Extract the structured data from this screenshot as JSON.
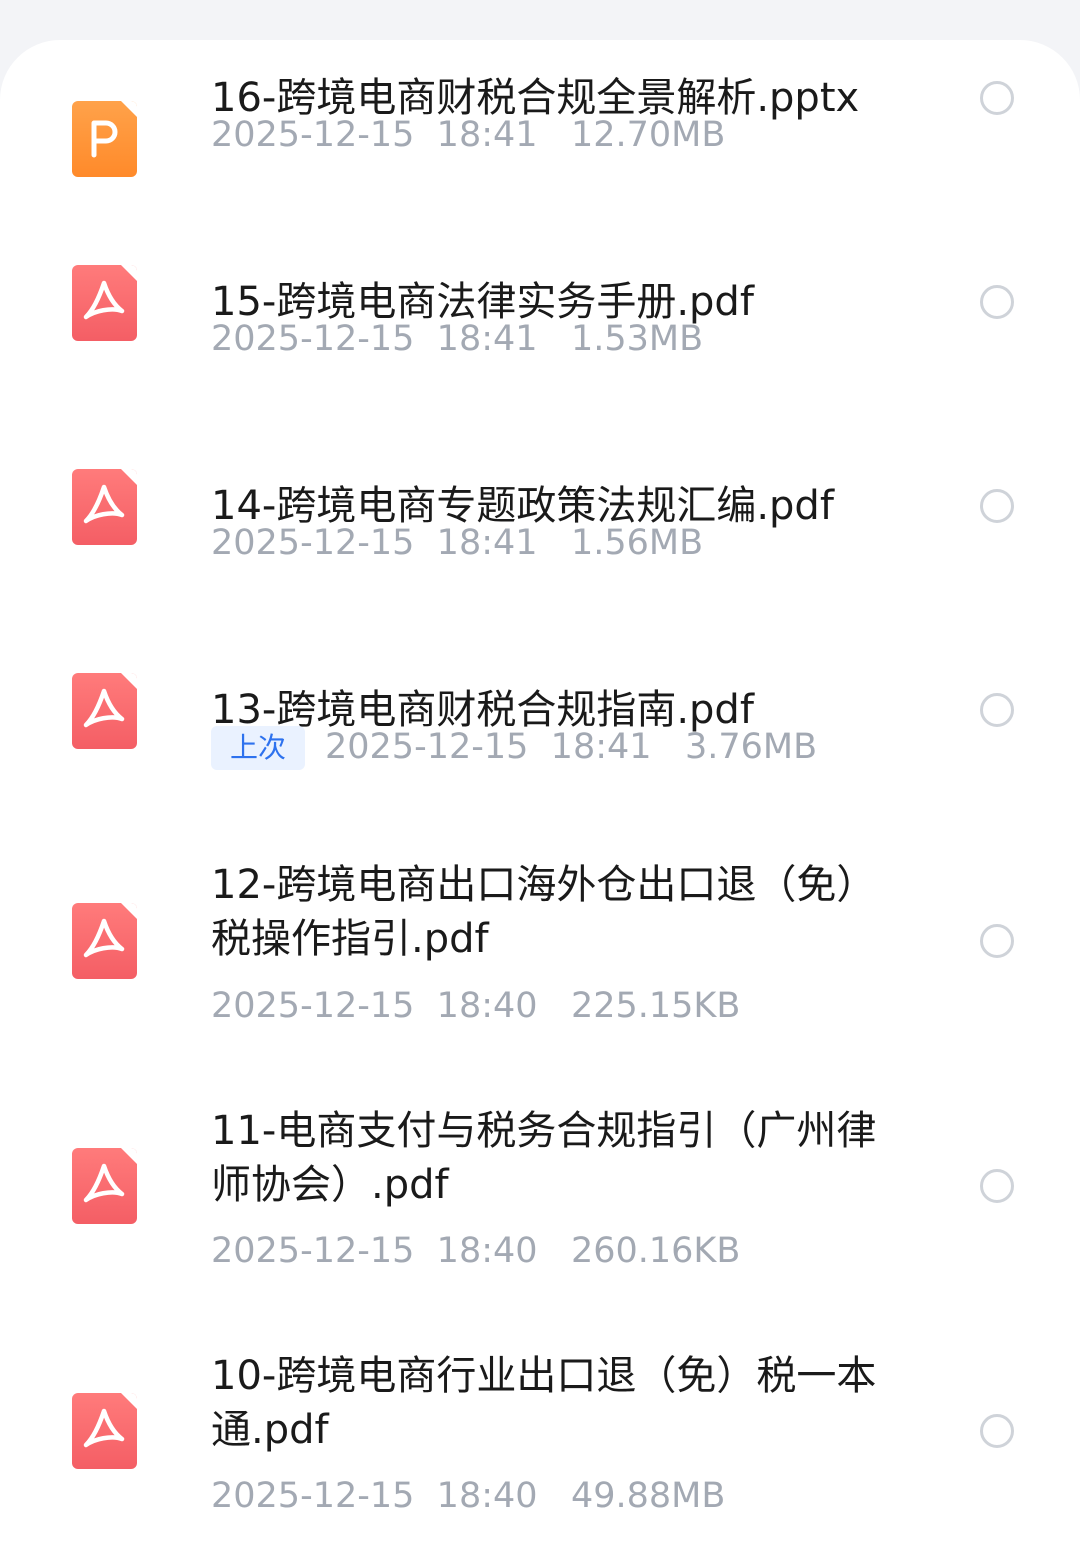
{
  "files": [
    {
      "title_line1": "16-跨境电商财税合规全景解析.pptx",
      "title_line2": "",
      "date": "2025-12-15",
      "time": "18:41",
      "size": "12.70MB",
      "badge": "",
      "type": "pptx"
    },
    {
      "title_line1": "15-跨境电商法律实务手册.pdf",
      "title_line2": "",
      "date": "2025-12-15",
      "time": "18:41",
      "size": "1.53MB",
      "badge": "",
      "type": "pdf"
    },
    {
      "title_line1": "14-跨境电商专题政策法规汇编.pdf",
      "title_line2": "",
      "date": "2025-12-15",
      "time": "18:41",
      "size": "1.56MB",
      "badge": "",
      "type": "pdf"
    },
    {
      "title_line1": "13-跨境电商财税合规指南.pdf",
      "title_line2": "",
      "date": "2025-12-15",
      "time": "18:41",
      "size": "3.76MB",
      "badge": "上次",
      "type": "pdf"
    },
    {
      "title_line1": "12-跨境电商出口海外仓出口退（免）",
      "title_line2": "税操作指引.pdf",
      "date": "2025-12-15",
      "time": "18:40",
      "size": "225.15KB",
      "badge": "",
      "type": "pdf"
    },
    {
      "title_line1": "11-电商支付与税务合规指引（广州律",
      "title_line2": "师协会）.pdf",
      "date": "2025-12-15",
      "time": "18:40",
      "size": "260.16KB",
      "badge": "",
      "type": "pdf"
    },
    {
      "title_line1": "10-跨境电商行业出口退（免）税一本",
      "title_line2": "通.pdf",
      "date": "2025-12-15",
      "time": "18:40",
      "size": "49.88MB",
      "badge": "",
      "type": "pdf"
    }
  ],
  "icons": {
    "pptx": "ppt-file-icon",
    "pdf": "pdf-file-icon",
    "select": "radio-circle-icon"
  },
  "colors": {
    "accent": "#2e72ee",
    "meta": "#a3a9b3",
    "pdf": "#f45e65",
    "ppt": "#ff8a2a"
  }
}
